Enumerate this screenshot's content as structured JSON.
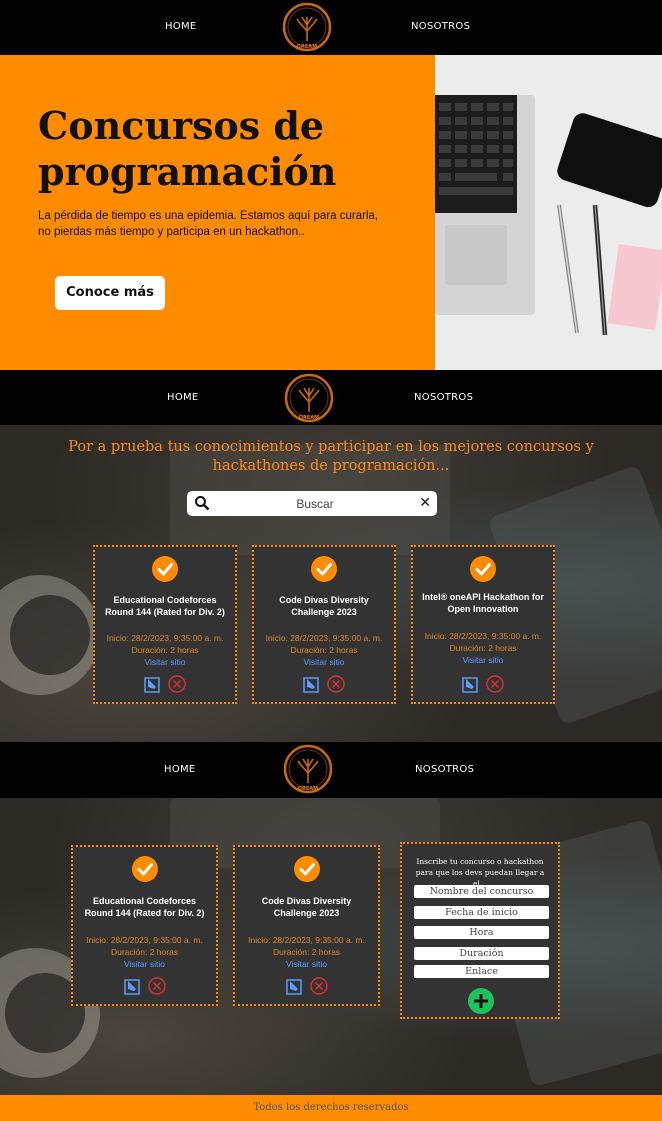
{
  "nav": {
    "home": "HOME",
    "about": "NOSOTROS",
    "logo_text": "DREAM"
  },
  "hero": {
    "title": "Concursos de programación",
    "text": "La pérdida de tiempo es una epidemia. Estamos aquí para curarla, no pierdas más tiempo y participa en un hackathon..",
    "button": "Conoce más"
  },
  "tagline": "Por a prueba tus conocimientos y participar en los mejores concursos y hackathones de programación...",
  "search": {
    "placeholder": "Buscar",
    "clear": "✕"
  },
  "contests": [
    {
      "title": "Educational Codeforces Round 144 (Rated for Div. 2)",
      "start": "Inicio: 28/2/2023, 9:35:00 a. m.",
      "duration": "Duración: 2 horas",
      "link": "Visitar sitio"
    },
    {
      "title": "Code Divas Diversity Challenge 2023",
      "start": "Inicio: 28/2/2023, 9:35:00 a. m.",
      "duration": "Duración: 2 horas",
      "link": "Visitar sitio"
    },
    {
      "title": "Intel® oneAPI Hackathon for Open Innovation",
      "start": "Inicio: 28/2/2023, 9:35:00 a. m.",
      "duration": "Duración: 2 horas",
      "link": "Visitar sitio"
    }
  ],
  "form": {
    "title": "Inscribe tu concurso o hackathon para que los devs puedan llegar a el...",
    "name_placeholder": "Nombre del concurso",
    "date_placeholder": "Fecha de inicio",
    "time_placeholder": "Hora",
    "duration_placeholder": "Duración",
    "link_placeholder": "Enlace"
  },
  "footer": "Todos los derechos reservados",
  "colors": {
    "accent": "#ff8c00",
    "card": "#333333",
    "link": "#5b9cff",
    "add": "#1ec25c"
  }
}
